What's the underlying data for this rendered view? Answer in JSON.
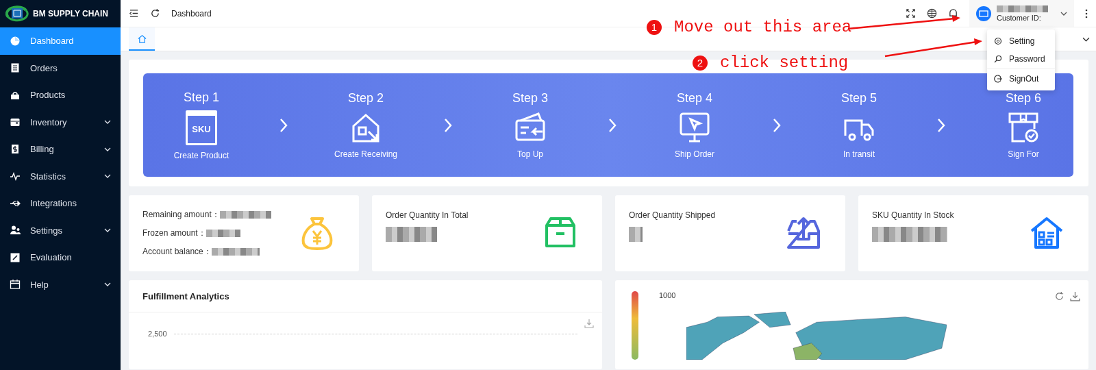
{
  "sidebar": {
    "brand": "BM SUPPLY CHAIN",
    "items": [
      {
        "label": "Dashboard",
        "selected": true,
        "expandable": false
      },
      {
        "label": "Orders",
        "selected": false,
        "expandable": false
      },
      {
        "label": "Products",
        "selected": false,
        "expandable": false
      },
      {
        "label": "Inventory",
        "selected": false,
        "expandable": true
      },
      {
        "label": "Billing",
        "selected": false,
        "expandable": true
      },
      {
        "label": "Statistics",
        "selected": false,
        "expandable": true
      },
      {
        "label": "Integrations",
        "selected": false,
        "expandable": false
      },
      {
        "label": "Settings",
        "selected": false,
        "expandable": true
      },
      {
        "label": "Evaluation",
        "selected": false,
        "expandable": false
      },
      {
        "label": "Help",
        "selected": false,
        "expandable": true
      }
    ]
  },
  "header": {
    "breadcrumb": "Dashboard",
    "customer_id_label": "Customer ID:"
  },
  "user_menu": {
    "items": [
      "Setting",
      "Password",
      "SignOut"
    ]
  },
  "steps": [
    {
      "title": "Step 1",
      "label": "Create Product",
      "icon_text": "SKU"
    },
    {
      "title": "Step 2",
      "label": "Create Receiving"
    },
    {
      "title": "Step 3",
      "label": "Top Up"
    },
    {
      "title": "Step 4",
      "label": "Ship Order"
    },
    {
      "title": "Step 5",
      "label": "In transit"
    },
    {
      "title": "Step 6",
      "label": "Sign For"
    }
  ],
  "balance_card": {
    "lines": [
      "Remaining amount：",
      "Frozen amount：",
      "Account balance："
    ]
  },
  "stat_cards": [
    {
      "title": "Order Quantity In Total",
      "color": "#22c063"
    },
    {
      "title": "Order Quantity Shipped",
      "color": "#5566dd"
    },
    {
      "title": "SKU Quantity In Stock",
      "color": "#1677ff"
    }
  ],
  "fulfillment": {
    "title": "Fulfillment Analytics",
    "y_tick": "2,500"
  },
  "map": {
    "legend_max": "1000"
  },
  "annotations": [
    {
      "number": "1",
      "text": "Move out this area"
    },
    {
      "number": "2",
      "text": "click setting"
    }
  ]
}
